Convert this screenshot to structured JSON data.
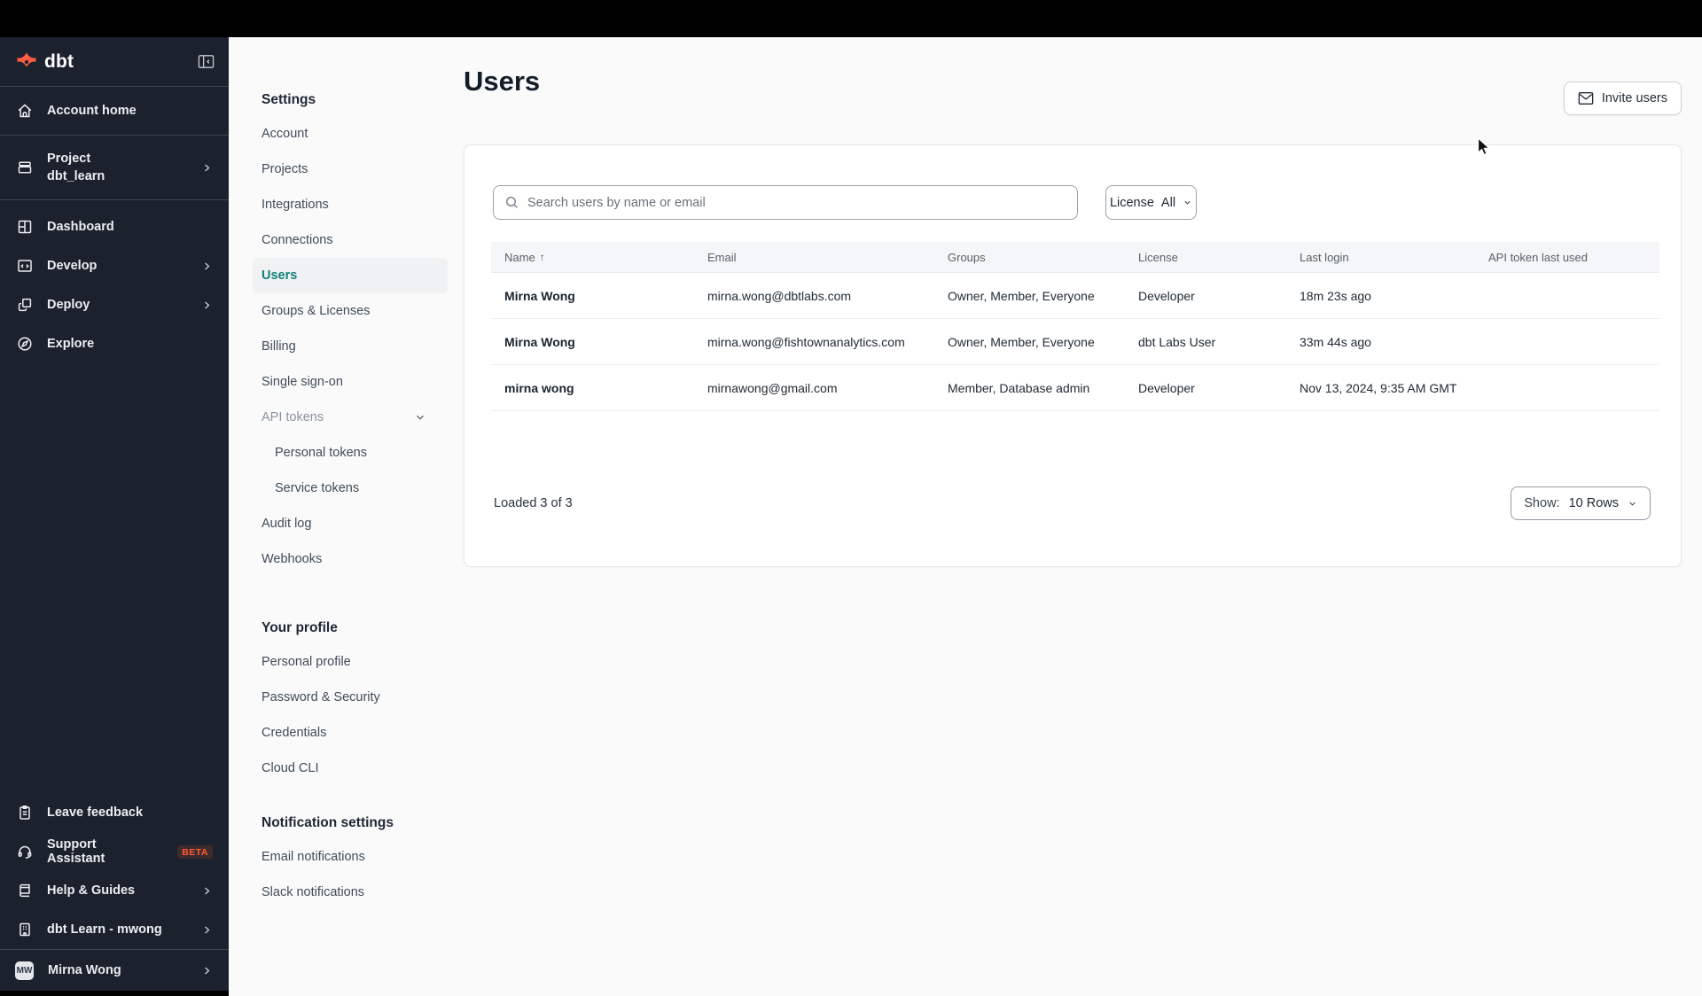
{
  "sidebar": {
    "logo_text": "dbt",
    "items": [
      {
        "label": "Account home"
      },
      {
        "label": "Project",
        "sublabel": "dbt_learn"
      },
      {
        "label": "Dashboard"
      },
      {
        "label": "Develop"
      },
      {
        "label": "Deploy"
      },
      {
        "label": "Explore"
      }
    ],
    "footer_items": [
      {
        "label": "Leave feedback"
      },
      {
        "label": "Support Assistant",
        "badge": "BETA"
      },
      {
        "label": "Help & Guides"
      },
      {
        "label": "dbt Learn - mwong"
      }
    ],
    "user": {
      "name": "Mirna Wong",
      "initials": "MW"
    }
  },
  "settings_nav": {
    "sections": [
      {
        "heading": "Settings",
        "items": [
          "Account",
          "Projects",
          "Integrations",
          "Connections",
          "Users",
          "Groups & Licenses",
          "Billing",
          "Single sign-on",
          "API tokens",
          "Personal tokens",
          "Service tokens",
          "Audit log",
          "Webhooks"
        ]
      },
      {
        "heading": "Your profile",
        "items": [
          "Personal profile",
          "Password & Security",
          "Credentials",
          "Cloud CLI"
        ]
      },
      {
        "heading": "Notification settings",
        "items": [
          "Email notifications",
          "Slack notifications"
        ]
      }
    ]
  },
  "main": {
    "title": "Users",
    "invite_button_label": "Invite users",
    "search_placeholder": "Search users by name or email",
    "license_filter": {
      "label": "License",
      "value": "All"
    },
    "table": {
      "columns": [
        "Name",
        "Email",
        "Groups",
        "License",
        "Last login",
        "API token last used"
      ],
      "rows": [
        {
          "name": "Mirna Wong",
          "email": "mirna.wong@dbtlabs.com",
          "groups": "Owner, Member, Everyone",
          "license": "Developer",
          "last_login": "18m 23s ago",
          "api_token_last_used": ""
        },
        {
          "name": "Mirna Wong",
          "email": "mirna.wong@fishtownanalytics.com",
          "groups": "Owner, Member, Everyone",
          "license": "dbt Labs User",
          "last_login": "33m 44s ago",
          "api_token_last_used": ""
        },
        {
          "name": "mirna wong",
          "email": "mirnawong@gmail.com",
          "groups": "Member, Database admin",
          "license": "Developer",
          "last_login": "Nov 13, 2024, 9:35 AM GMT",
          "api_token_last_used": ""
        }
      ],
      "loaded_text": "Loaded 3 of 3",
      "show_label": "Show:",
      "show_value": "10 Rows"
    }
  },
  "colors": {
    "brand_orange": "#ff5c35",
    "active_teal": "#13807b",
    "sidebar_bg": "#1b212d",
    "topbar_bg": "#000000",
    "page_bg": "#fafafb"
  }
}
